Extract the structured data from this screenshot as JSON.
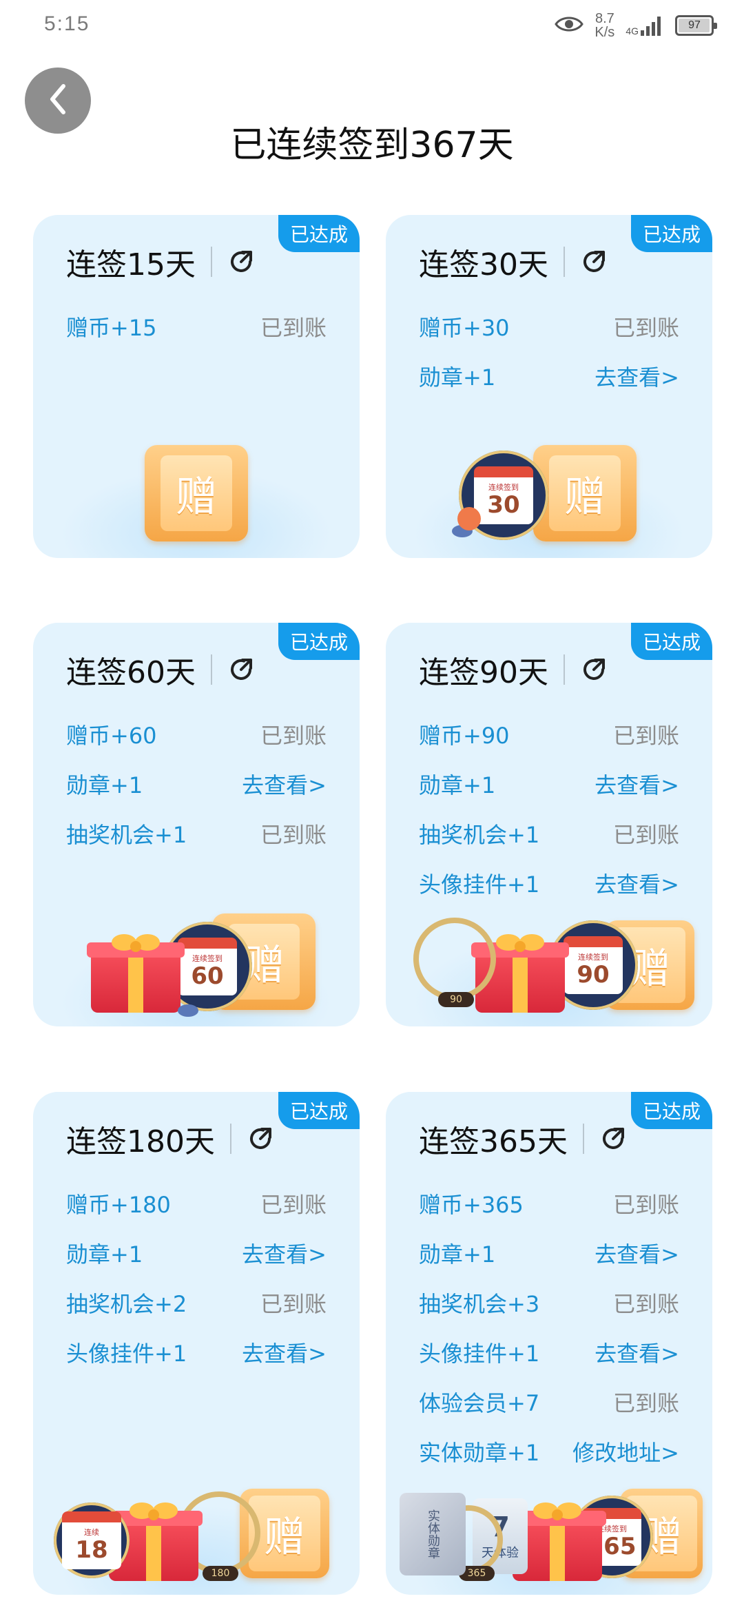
{
  "status_bar": {
    "time": "5:15",
    "net_speed_value": "8.7",
    "net_speed_unit": "K/s",
    "signal_label": "4G",
    "battery": "97"
  },
  "header": {
    "title": "已连续签到367天"
  },
  "cards": [
    {
      "badge": "已达成",
      "title": "连签15天",
      "rewards": [
        {
          "name": "赠币+15",
          "status": "已到账"
        }
      ],
      "illustration": {
        "ticket_char": "赠"
      }
    },
    {
      "badge": "已达成",
      "title": "连签30天",
      "rewards": [
        {
          "name": "赠币+30",
          "status": "已到账"
        },
        {
          "name": "勋章+1",
          "status": "去查看>"
        }
      ],
      "illustration": {
        "ticket_char": "赠",
        "medal_label": "连续签到",
        "medal_number": "30"
      }
    },
    {
      "badge": "已达成",
      "title": "连签60天",
      "rewards": [
        {
          "name": "赠币+60",
          "status": "已到账"
        },
        {
          "name": "勋章+1",
          "status": "去查看>"
        },
        {
          "name": "抽奖机会+1",
          "status": "已到账"
        }
      ],
      "illustration": {
        "ticket_char": "赠",
        "medal_label": "连续签到",
        "medal_number": "60"
      }
    },
    {
      "badge": "已达成",
      "title": "连签90天",
      "rewards": [
        {
          "name": "赠币+90",
          "status": "已到账"
        },
        {
          "name": "勋章+1",
          "status": "去查看>"
        },
        {
          "name": "抽奖机会+1",
          "status": "已到账"
        },
        {
          "name": "头像挂件+1",
          "status": "去查看>"
        }
      ],
      "illustration": {
        "ticket_char": "赠",
        "medal_label": "连续签到",
        "medal_number": "90",
        "frame_tag": "90"
      }
    },
    {
      "badge": "已达成",
      "title": "连签180天",
      "rewards": [
        {
          "name": "赠币+180",
          "status": "已到账"
        },
        {
          "name": "勋章+1",
          "status": "去查看>"
        },
        {
          "name": "抽奖机会+2",
          "status": "已到账"
        },
        {
          "name": "头像挂件+1",
          "status": "去查看>"
        }
      ],
      "illustration": {
        "ticket_char": "赠",
        "medal_label": "连续",
        "medal_number": "18",
        "frame_tag": "180"
      }
    },
    {
      "badge": "已达成",
      "title": "连签365天",
      "rewards": [
        {
          "name": "赠币+365",
          "status": "已到账"
        },
        {
          "name": "勋章+1",
          "status": "去查看>"
        },
        {
          "name": "抽奖机会+3",
          "status": "已到账"
        },
        {
          "name": "头像挂件+1",
          "status": "去查看>"
        },
        {
          "name": "体验会员+7",
          "status": "已到账"
        },
        {
          "name": "实体勋章+1",
          "status": "修改地址>"
        }
      ],
      "illustration": {
        "ticket_char": "赠",
        "medal_label": "连续签到",
        "medal_number": "365",
        "frame_tag": "365",
        "phys_label": "实体勋章",
        "member_number": "7",
        "member_label": "天体验"
      }
    }
  ],
  "colors": {
    "accent": "#159ceb",
    "reward_text": "#1a8fd2",
    "muted": "#8c8c8c",
    "card_bg": "#e3f3fd",
    "back_btn": "#8e8e8e"
  },
  "icons": {
    "back": "chevron-left-icon",
    "share": "share-icon",
    "eye": "eye-icon",
    "signal": "signal-icon",
    "battery": "battery-icon"
  }
}
